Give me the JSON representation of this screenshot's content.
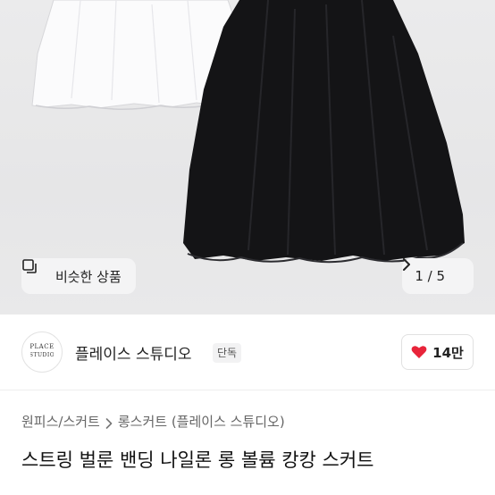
{
  "gallery": {
    "similar_button_label": "비슷한 상품",
    "similar_icon": "similar-items-icon",
    "pager_text": "1 / 5",
    "next_icon": "chevron-right-icon"
  },
  "seller": {
    "logo_text": "PLACE STUDIO",
    "name": "플레이스 스튜디오",
    "badge": "단독",
    "likes": "14만",
    "like_icon": "heart-icon",
    "like_color": "#e8243a"
  },
  "breadcrumb": {
    "category": "원피스/스커트",
    "subcategory": "롱스커트 (플레이스 스튜디오)",
    "separator_icon": "chevron-right-icon"
  },
  "product": {
    "title": "스트링 벌룬 밴딩 나일론 롱 볼륨 캉캉 스커트"
  }
}
